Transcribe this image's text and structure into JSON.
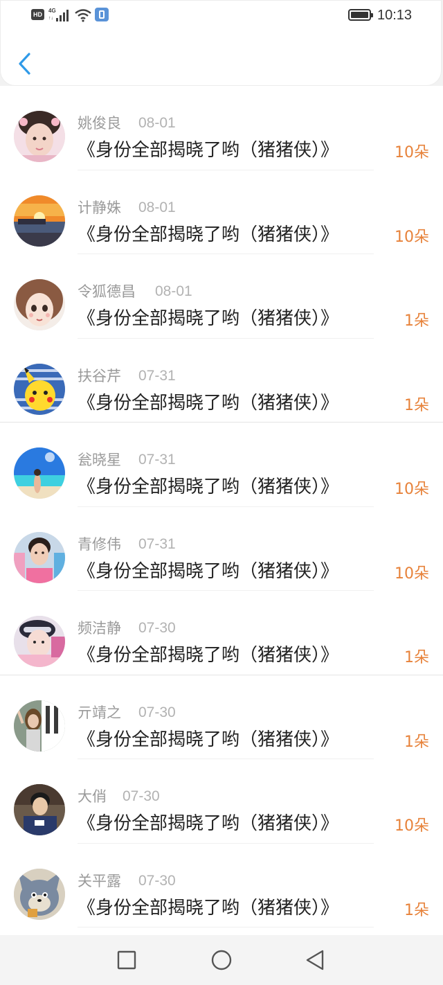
{
  "status_bar": {
    "hd": "HD",
    "network": "4G",
    "network_sub": "↑↓",
    "time": "10:13",
    "icons": [
      "hd-badge-icon",
      "signal-icon",
      "wifi-icon",
      "sim-icon",
      "battery-icon"
    ]
  },
  "header": {
    "back_icon": "chevron-left-icon",
    "accent_color": "#2f9ae8"
  },
  "records": [
    {
      "name": "姚俊良",
      "date": "08-01",
      "title": "《身份全部揭晓了哟（猪猪侠）》",
      "flowers": "10朵"
    },
    {
      "name": "计静姝",
      "date": "08-01",
      "title": "《身份全部揭晓了哟（猪猪侠）》",
      "flowers": "10朵"
    },
    {
      "name": "令狐德昌",
      "date": "08-01",
      "title": "《身份全部揭晓了哟（猪猪侠）》",
      "flowers": "1朵"
    },
    {
      "name": "扶谷芹",
      "date": "07-31",
      "title": "《身份全部揭晓了哟（猪猪侠）》",
      "flowers": "1朵"
    },
    {
      "name": "瓮晓星",
      "date": "07-31",
      "title": "《身份全部揭晓了哟（猪猪侠）》",
      "flowers": "10朵"
    },
    {
      "name": "青修伟",
      "date": "07-31",
      "title": "《身份全部揭晓了哟（猪猪侠）》",
      "flowers": "10朵"
    },
    {
      "name": "频洁静",
      "date": "07-30",
      "title": "《身份全部揭晓了哟（猪猪侠）》",
      "flowers": "1朵"
    },
    {
      "name": "亓靖之",
      "date": "07-30",
      "title": "《身份全部揭晓了哟（猪猪侠）》",
      "flowers": "1朵"
    },
    {
      "name": "大俏",
      "date": "07-30",
      "title": "《身份全部揭晓了哟（猪猪侠）》",
      "flowers": "10朵"
    },
    {
      "name": "关平露",
      "date": "07-30",
      "title": "《身份全部揭晓了哟（猪猪侠）》",
      "flowers": "1朵"
    }
  ],
  "nav_bar": {
    "icons": [
      "square-icon",
      "circle-icon",
      "triangle-back-icon"
    ]
  },
  "colors": {
    "flower_count": "#e7823a",
    "name": "#9a9a9a",
    "date": "#b2b2b2",
    "title": "#222222"
  }
}
